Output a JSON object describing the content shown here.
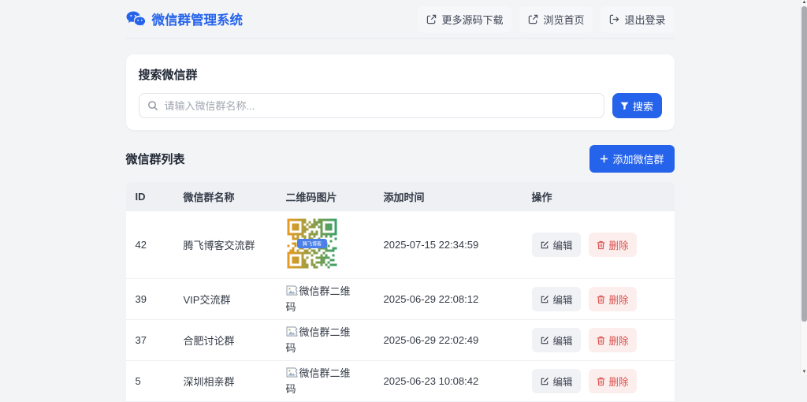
{
  "header": {
    "title": "微信群管理系统",
    "nav": [
      {
        "label": "更多源码下载",
        "icon": "external-link-icon"
      },
      {
        "label": "浏览首页",
        "icon": "external-link-icon"
      },
      {
        "label": "退出登录",
        "icon": "logout-icon"
      }
    ]
  },
  "search": {
    "title": "搜索微信群",
    "placeholder": "请输入微信群名称...",
    "button_label": "搜索"
  },
  "list": {
    "title": "微信群列表",
    "add_button_label": "添加微信群"
  },
  "table": {
    "columns": [
      "ID",
      "微信群名称",
      "二维码图片",
      "添加时间",
      "操作"
    ],
    "edit_label": "编辑",
    "delete_label": "删除",
    "qr_alt_text": "微信群二维码",
    "qr_badge_text": "腾飞博客",
    "rows": [
      {
        "id": "42",
        "name": "腾飞博客交流群",
        "qr": "qr-image",
        "added": "2025-07-15 22:34:59"
      },
      {
        "id": "39",
        "name": "VIP交流群",
        "qr": "broken",
        "added": "2025-06-29 22:08:12"
      },
      {
        "id": "37",
        "name": "合肥讨论群",
        "qr": "broken",
        "added": "2025-06-29 22:02:49"
      },
      {
        "id": "5",
        "name": "深圳相亲群",
        "qr": "broken",
        "added": "2025-06-23 10:08:42"
      }
    ]
  },
  "colors": {
    "accent": "#2563eb",
    "delete_text": "#d9534f",
    "delete_bg": "#fdeeee",
    "edit_bg": "#f1f2f5",
    "table_head_bg": "#eef0f3",
    "page_bg": "#f3f4f6",
    "qr_orange": "#e69b23",
    "qr_green": "#3ca069"
  }
}
